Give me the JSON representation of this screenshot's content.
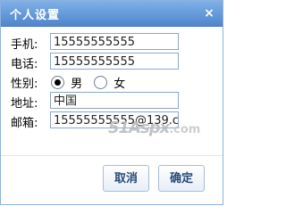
{
  "dialog": {
    "title": "个人设置",
    "close_icon": "×"
  },
  "form": {
    "phone": {
      "label": "手机:",
      "value": "15555555555"
    },
    "tel": {
      "label": "电话:",
      "value": "15555555555"
    },
    "gender": {
      "label": "性别:",
      "options": [
        {
          "label": "男",
          "checked": true
        },
        {
          "label": "女",
          "checked": false
        }
      ]
    },
    "address": {
      "label": "地址:",
      "value": "中国"
    },
    "email": {
      "label": "邮箱:",
      "value": "15555555555@139.c"
    }
  },
  "watermark": {
    "main": "51Aspx",
    "suffix": ".com"
  },
  "buttons": {
    "cancel_label": "取消",
    "ok_label": "确定"
  },
  "colors": {
    "title_bar": "#4f86cc",
    "border": "#8cb2dc",
    "button_text": "#274a78"
  }
}
